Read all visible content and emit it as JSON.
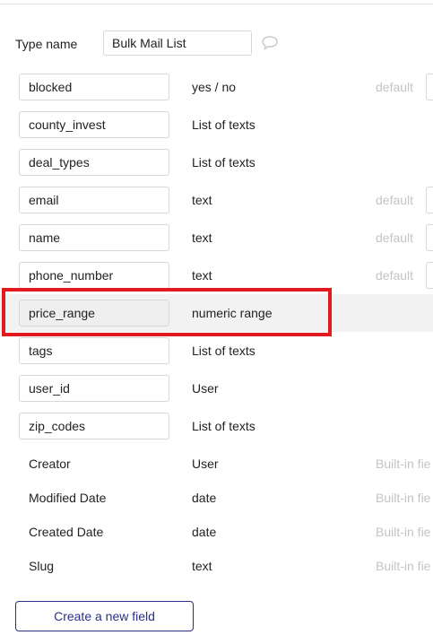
{
  "type_name": {
    "label": "Type name",
    "value": "Bulk Mail List",
    "comment_icon": "speech-bubble-icon"
  },
  "fields": [
    {
      "name": "blocked",
      "type": "yes / no",
      "default_label": "default",
      "has_default": true
    },
    {
      "name": "county_invest",
      "type": "List of texts",
      "default_label": "",
      "has_default": false
    },
    {
      "name": "deal_types",
      "type": "List of texts",
      "default_label": "",
      "has_default": false
    },
    {
      "name": "email",
      "type": "text",
      "default_label": "default",
      "has_default": true
    },
    {
      "name": "name",
      "type": "text",
      "default_label": "default",
      "has_default": true
    },
    {
      "name": "phone_number",
      "type": "text",
      "default_label": "default",
      "has_default": true
    },
    {
      "name": "price_range",
      "type": "numeric range",
      "default_label": "",
      "has_default": false,
      "highlighted": true
    },
    {
      "name": "tags",
      "type": "List of texts",
      "default_label": "",
      "has_default": false
    },
    {
      "name": "user_id",
      "type": "User",
      "default_label": "",
      "has_default": false
    },
    {
      "name": "zip_codes",
      "type": "List of texts",
      "default_label": "",
      "has_default": false
    }
  ],
  "builtin_fields": [
    {
      "name": "Creator",
      "type": "User",
      "tag": "Built-in fie"
    },
    {
      "name": "Modified Date",
      "type": "date",
      "tag": "Built-in fie"
    },
    {
      "name": "Created Date",
      "type": "date",
      "tag": "Built-in fie"
    },
    {
      "name": "Slug",
      "type": "text",
      "tag": "Built-in fie"
    }
  ],
  "create_button": {
    "label": "Create a new field"
  },
  "colors": {
    "accent": "#2b2e8a",
    "annotation": "#e3191c",
    "muted": "#c4c4c4",
    "highlight_row": "#f2f2f2"
  }
}
